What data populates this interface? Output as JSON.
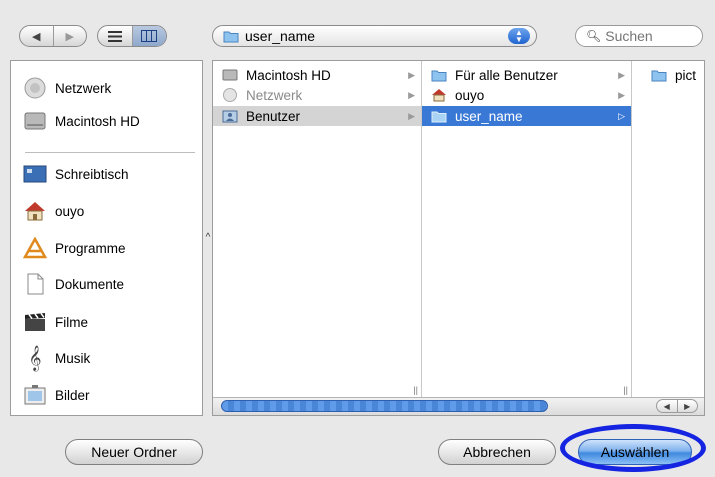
{
  "toolbar": {
    "nav_back_icon": "back-arrow-icon",
    "nav_forward_icon": "forward-arrow-icon",
    "view_list_icon": "list-view-icon",
    "view_column_icon": "column-view-icon",
    "location_value": "user_name",
    "search_placeholder": "Suchen"
  },
  "sidebar": {
    "items": [
      {
        "label": "Netzwerk",
        "icon": "network-icon"
      },
      {
        "label": "Macintosh HD",
        "icon": "hard-disk-icon"
      },
      {
        "label": "Schreibtisch",
        "icon": "desktop-icon"
      },
      {
        "label": "ouyo",
        "icon": "home-icon"
      },
      {
        "label": "Programme",
        "icon": "applications-icon"
      },
      {
        "label": "Dokumente",
        "icon": "documents-icon"
      },
      {
        "label": "Filme",
        "icon": "movies-icon"
      },
      {
        "label": "Musik",
        "icon": "music-icon"
      },
      {
        "label": "Bilder",
        "icon": "pictures-icon"
      }
    ]
  },
  "browser": {
    "col1": [
      {
        "label": "Macintosh HD",
        "icon": "hard-disk-icon"
      },
      {
        "label": "Netzwerk",
        "icon": "network-icon",
        "dim": true
      },
      {
        "label": "Benutzer",
        "icon": "users-folder-icon",
        "selected": "gray"
      }
    ],
    "col2": [
      {
        "label": "Für alle Benutzer",
        "icon": "folder-icon"
      },
      {
        "label": "ouyo",
        "icon": "home-icon"
      },
      {
        "label": "user_name",
        "icon": "folder-icon",
        "selected": "blue"
      }
    ],
    "col3": [
      {
        "label": "pict",
        "icon": "folder-icon"
      }
    ]
  },
  "buttons": {
    "new_folder": "Neuer Ordner",
    "cancel": "Abbrechen",
    "choose": "Auswählen"
  },
  "colors": {
    "selection_blue": "#3a78d6",
    "highlight_ring": "#1524e0"
  }
}
